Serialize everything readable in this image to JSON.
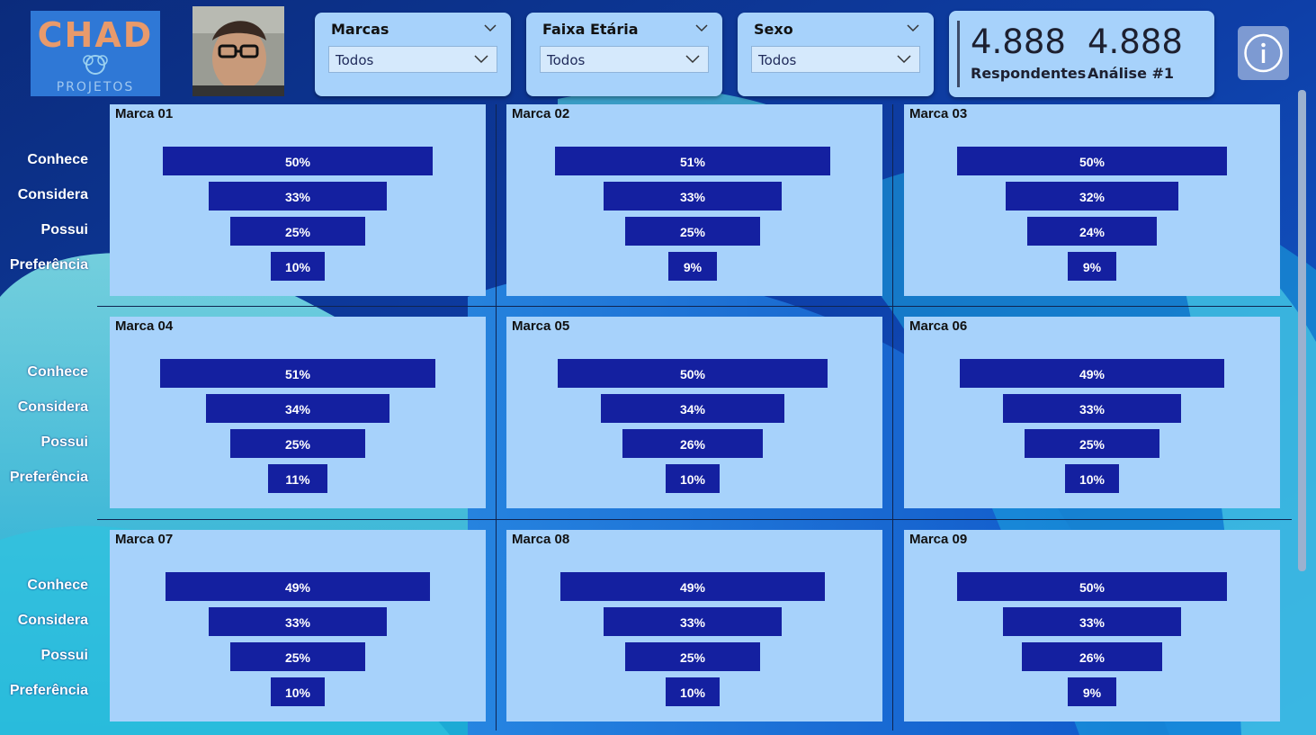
{
  "logo": {
    "text_top": "CHAD",
    "text_bottom": "PROJETOS"
  },
  "filters": [
    {
      "title": "Marcas",
      "value": "Todos"
    },
    {
      "title": "Faixa Etária",
      "value": "Todos"
    },
    {
      "title": "Sexo",
      "value": "Todos"
    }
  ],
  "kpis": [
    {
      "value": "4.888",
      "label": "Respondentes"
    },
    {
      "value": "4.888",
      "label": "Análise #1"
    }
  ],
  "stages": [
    "Conhece",
    "Considera",
    "Possui",
    "Preferência"
  ],
  "chart_data": [
    {
      "type": "bar",
      "title": "Marca 01",
      "categories": [
        "Conhece",
        "Considera",
        "Possui",
        "Preferência"
      ],
      "values": [
        50,
        33,
        25,
        10
      ],
      "labels": [
        "50%",
        "33%",
        "25%",
        "10%"
      ]
    },
    {
      "type": "bar",
      "title": "Marca 02",
      "categories": [
        "Conhece",
        "Considera",
        "Possui",
        "Preferência"
      ],
      "values": [
        51,
        33,
        25,
        9
      ],
      "labels": [
        "51%",
        "33%",
        "25%",
        "9%"
      ]
    },
    {
      "type": "bar",
      "title": "Marca 03",
      "categories": [
        "Conhece",
        "Considera",
        "Possui",
        "Preferência"
      ],
      "values": [
        50,
        32,
        24,
        9
      ],
      "labels": [
        "50%",
        "32%",
        "24%",
        "9%"
      ]
    },
    {
      "type": "bar",
      "title": "Marca 04",
      "categories": [
        "Conhece",
        "Considera",
        "Possui",
        "Preferência"
      ],
      "values": [
        51,
        34,
        25,
        11
      ],
      "labels": [
        "51%",
        "34%",
        "25%",
        "11%"
      ]
    },
    {
      "type": "bar",
      "title": "Marca 05",
      "categories": [
        "Conhece",
        "Considera",
        "Possui",
        "Preferência"
      ],
      "values": [
        50,
        34,
        26,
        10
      ],
      "labels": [
        "50%",
        "34%",
        "26%",
        "10%"
      ]
    },
    {
      "type": "bar",
      "title": "Marca 06",
      "categories": [
        "Conhece",
        "Considera",
        "Possui",
        "Preferência"
      ],
      "values": [
        49,
        33,
        25,
        10
      ],
      "labels": [
        "49%",
        "33%",
        "25%",
        "10%"
      ]
    },
    {
      "type": "bar",
      "title": "Marca 07",
      "categories": [
        "Conhece",
        "Considera",
        "Possui",
        "Preferência"
      ],
      "values": [
        49,
        33,
        25,
        10
      ],
      "labels": [
        "49%",
        "33%",
        "25%",
        "10%"
      ]
    },
    {
      "type": "bar",
      "title": "Marca 08",
      "categories": [
        "Conhece",
        "Considera",
        "Possui",
        "Preferência"
      ],
      "values": [
        49,
        33,
        25,
        10
      ],
      "labels": [
        "49%",
        "33%",
        "25%",
        "10%"
      ]
    },
    {
      "type": "bar",
      "title": "Marca 09",
      "categories": [
        "Conhece",
        "Considera",
        "Possui",
        "Preferência"
      ],
      "values": [
        50,
        33,
        26,
        9
      ],
      "labels": [
        "50%",
        "33%",
        "26%",
        "9%"
      ]
    }
  ],
  "colors": {
    "bar": "#1420a0",
    "panel": "#a7d2fb",
    "background": "#0a2a78"
  }
}
